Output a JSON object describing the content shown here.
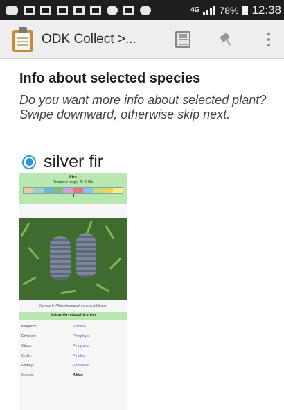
{
  "status_bar": {
    "network": "4G",
    "battery": "78%",
    "time": "12:38",
    "icons": [
      "game-controller-icon",
      "facebook-icon",
      "facebook-icon",
      "facebook-icon",
      "mail-icon",
      "gallery-icon",
      "wifi-icon",
      "message-icon",
      "check-icon"
    ]
  },
  "action_bar": {
    "title": "ODK Collect >...",
    "icons": [
      "clipboard-icon",
      "save-icon",
      "pin-icon",
      "more-vert-icon"
    ]
  },
  "question": {
    "heading": "Info about selected species",
    "hint": "Do you want more info about selected plant? Swipe downward, otherwise skip next."
  },
  "choice": {
    "label": "silver fir",
    "selected": true,
    "accent_color": "#2d98d6"
  },
  "infobox": {
    "genus": "Firs",
    "temporal_range": "Temporal range: 46–0 Ma",
    "caption": "Korean fir (Abies koreana) cone and foliage",
    "classification_title": "Scientific classification",
    "rows": [
      {
        "key": "Kingdom:",
        "value": "Plantae"
      },
      {
        "key": "Division:",
        "value": "Pinophyta"
      },
      {
        "key": "Class:",
        "value": "Pinopsida"
      },
      {
        "key": "Order:",
        "value": "Pinales"
      },
      {
        "key": "Family:",
        "value": "Pinaceae"
      },
      {
        "key": "Genus:",
        "value": "Abies"
      }
    ],
    "header_color": "#b8e7b0"
  }
}
